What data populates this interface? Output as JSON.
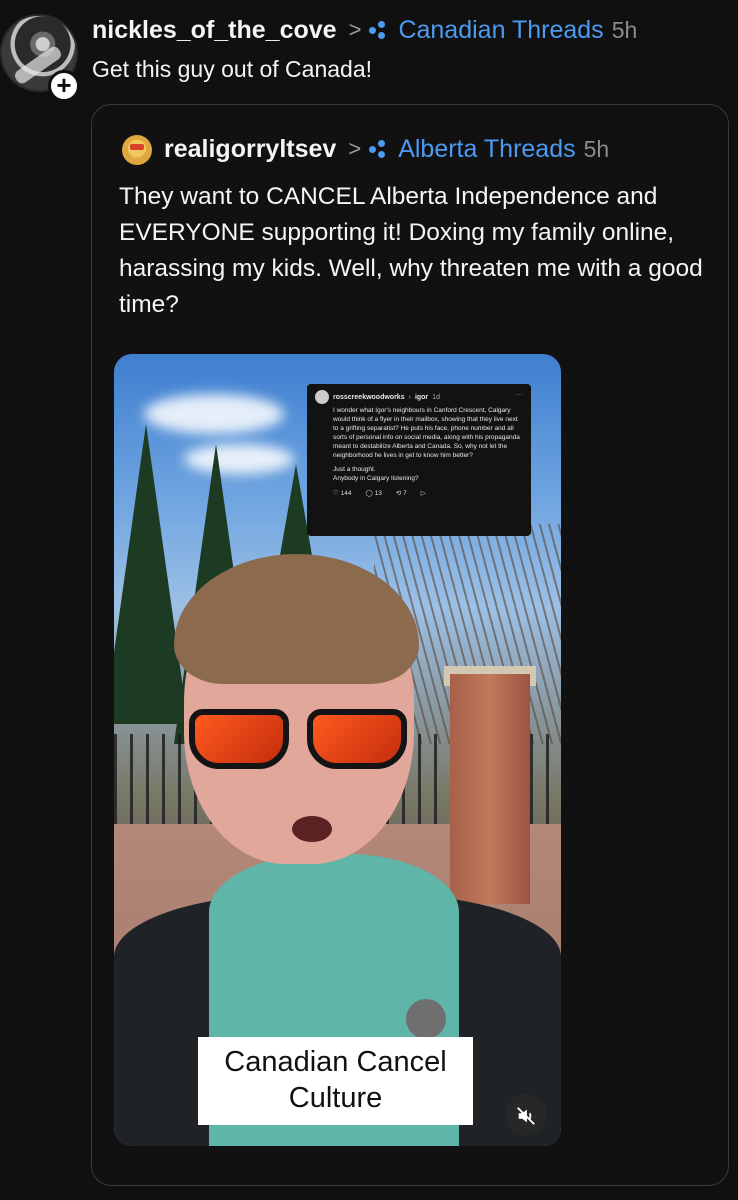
{
  "outer_post": {
    "username": "nickles_of_the_cove",
    "community": "Canadian Threads",
    "time": "5h",
    "text": "Get this guy out of Canada!",
    "follow_symbol": "+"
  },
  "quoted_post": {
    "username": "realigorryltsev",
    "community": "Alberta Threads",
    "time": "5h",
    "text": "They want to CANCEL Alberta Independence and EVERYONE supporting it! Doxing my family online, harassing my kids. Well, why threaten me with a good time?",
    "video": {
      "caption_line1": "Canadian Cancel",
      "caption_line2": "Culture",
      "mute_icon": "speaker-muted-icon",
      "embedded_post": {
        "username": "rosscreekwoodworks",
        "mention": "igor",
        "time": "1d",
        "body": "I wonder what Igor's neighbours in Canford Crescent, Calgary would think of a flyer in their mailbox, showing that they live next to a grifting separatist? He puts his face, phone number and all sorts of personal info on social media, along with his propaganda meant to destabilize Alberta and Canada. So, why not let the neighborhood he lives in get to know him better?",
        "footer_text1": "Just a thought.",
        "footer_text2": "Anybody in Calgary listening?",
        "likes": "144",
        "replies": "13",
        "reposts": "7"
      }
    }
  },
  "colors": {
    "background": "#101010",
    "accent": "#4c9bf0",
    "muted": "#8c8c8c"
  }
}
